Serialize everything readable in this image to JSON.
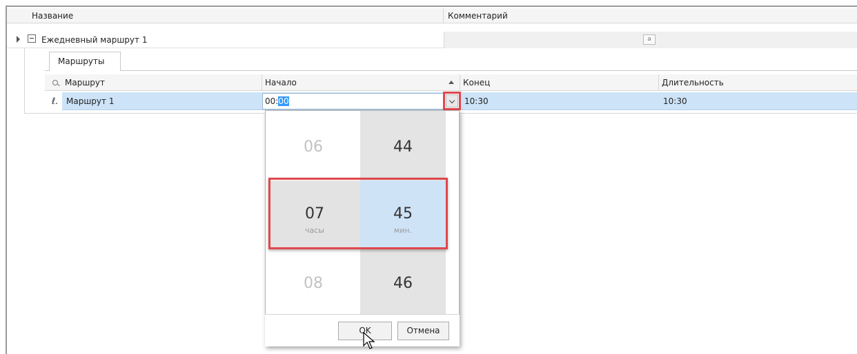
{
  "grid": {
    "columns": {
      "name": "Название",
      "comment": "Комментарий"
    },
    "row": {
      "label": "Ежедневный маршрут 1",
      "memo_icon": "a"
    }
  },
  "detail": {
    "tab_label": "Маршруты",
    "columns": {
      "route": "Маршрут",
      "start": "Начало",
      "end": "Конец",
      "duration": "Длительность"
    },
    "row": {
      "route": "Маршрут 1",
      "start_hours": "00:",
      "start_minutes": "00",
      "end": "10:30",
      "duration": "10:30"
    }
  },
  "time_picker": {
    "hours": {
      "prev": "06",
      "current": "07",
      "next": "08",
      "unit": "часы"
    },
    "minutes": {
      "prev": "44",
      "current": "45",
      "next": "46",
      "unit": "мин."
    },
    "ok_label": "OK",
    "cancel_label": "Отмена"
  },
  "colors": {
    "highlight_border": "#e0474c",
    "selection_blue": "#cde3f7"
  },
  "icons": [
    "expand-collapse-icon",
    "memo-icon",
    "search-icon",
    "edit-row-icon",
    "sort-ascending-icon",
    "dropdown-chevron-icon",
    "mouse-cursor-icon"
  ]
}
